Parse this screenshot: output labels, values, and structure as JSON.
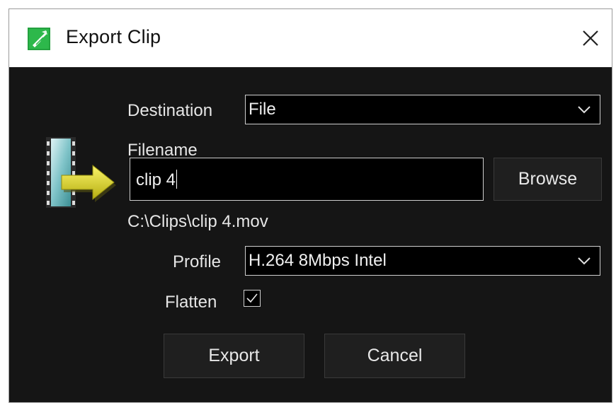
{
  "window": {
    "title": "Export Clip",
    "app_icon": "export-clip-app-icon",
    "close_icon": "close-icon"
  },
  "form": {
    "destination_label": "Destination",
    "destination_value": "File",
    "filename_label": "Filename",
    "filename_value": "clip 4",
    "browse_label": "Browse",
    "output_path": "C:\\Clips\\clip 4.mov",
    "profile_label": "Profile",
    "profile_value": "H.264 8Mbps Intel",
    "flatten_label": "Flatten",
    "flatten_checked": true
  },
  "actions": {
    "export_label": "Export",
    "cancel_label": "Cancel"
  },
  "icons": {
    "dialog_icon": "film-export-arrow-icon",
    "dropdown_icon": "chevron-down-icon",
    "check_icon": "checkmark-icon"
  },
  "colors": {
    "dialog_background": "#151515",
    "titlebar_background": "#ffffff",
    "field_background": "#000000",
    "button_background": "#1f1f1f",
    "text": "#e6e6e6",
    "app_icon_green": "#2db84b",
    "arrow_yellow": "#d9d21a"
  }
}
